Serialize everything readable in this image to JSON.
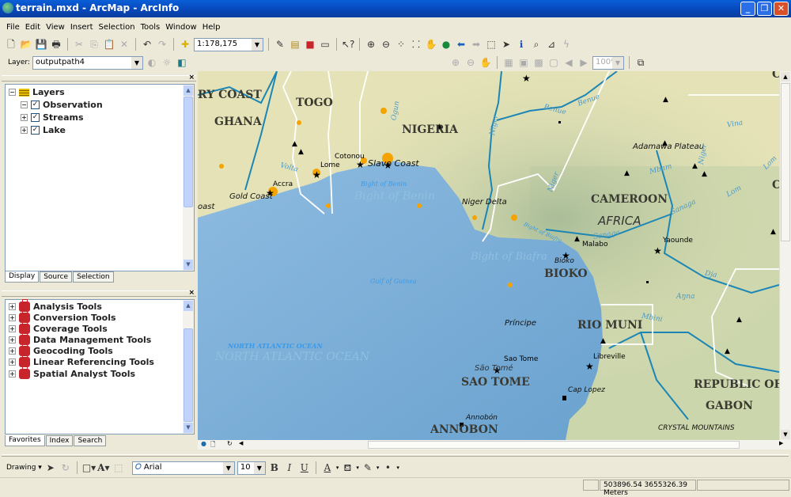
{
  "window": {
    "title": "terrain.mxd - ArcMap - ArcInfo",
    "controls": [
      "minimize",
      "maximize",
      "close"
    ]
  },
  "menu": [
    "File",
    "Edit",
    "View",
    "Insert",
    "Selection",
    "Tools",
    "Window",
    "Help"
  ],
  "standard_toolbar": {
    "scale": "1:178,175",
    "icons": [
      "new-icon",
      "open-icon",
      "save-icon",
      "print-icon",
      "cut-icon",
      "copy-icon",
      "paste-icon",
      "delete-icon",
      "undo-icon",
      "redo-icon",
      "add-data-icon",
      "editor-icon",
      "arccatalog-icon",
      "arctoolbox-icon",
      "command-line-icon",
      "whats-this-icon"
    ]
  },
  "tools_toolbar": {
    "icons": [
      "zoom-in-icon",
      "zoom-out-icon",
      "fixed-zoom-in-icon",
      "fixed-zoom-out-icon",
      "pan-icon",
      "full-extent-icon",
      "back-icon",
      "forward-icon",
      "select-features-icon",
      "select-elements-icon",
      "identify-icon",
      "find-icon",
      "measure-icon",
      "hyperlink-icon"
    ]
  },
  "effects_toolbar": {
    "layer_label": "Layer:",
    "layer_value": "outputpath4"
  },
  "layout_toolbar": {
    "zoom": "100%"
  },
  "toc": {
    "root": "Layers",
    "layers": [
      {
        "name": "Observation",
        "checked": true,
        "expanded": true
      },
      {
        "name": "Streams",
        "checked": true,
        "expanded": false
      },
      {
        "name": "Lake",
        "checked": true,
        "expanded": false
      }
    ],
    "tabs": [
      "Display",
      "Source",
      "Selection"
    ],
    "active_tab": "Display"
  },
  "toolbox": {
    "items": [
      "Analysis Tools",
      "Conversion Tools",
      "Coverage Tools",
      "Data Management Tools",
      "Geocoding Tools",
      "Linear Referencing Tools",
      "Spatial Analyst Tools"
    ],
    "tabs": [
      "Favorites",
      "Index",
      "Search"
    ],
    "active_tab": "Favorites"
  },
  "map": {
    "countries": [
      "RY COAST",
      "TOGO",
      "GHANA",
      "NIGERIA",
      "CAMEROON",
      "BIOKO",
      "RIO MUNI",
      "SAO TOME",
      "REPUBLIC OF",
      "GABON",
      "ANNOBON",
      "C",
      "C"
    ],
    "cities": [
      "Cotonou",
      "Lome",
      "Accra",
      "Malabo",
      "Yaounde",
      "Sao Tome",
      "Libreville"
    ],
    "places": [
      "Slave Coast",
      "Gold Coast",
      "oast",
      "Niger Delta",
      "Adamawa Plateau",
      "AFRICA",
      "Bioko",
      "Príncipe",
      "São Tomé",
      "Cap Lopez",
      "Annobón",
      "CRYSTAL MOUNTAINS"
    ],
    "water": [
      "Bight of Benin",
      "Bight of Benin",
      "Gulf of Guinea",
      "Bight of Biafra",
      "Bight of Biafra",
      "NORTH ATLANTIC OCEAN",
      "NORTH ATLANTIC OCEAN"
    ],
    "rivers": [
      "Volta",
      "Ogun",
      "Niger",
      "Niger",
      "Benue",
      "Benue",
      "Vina",
      "Mbam",
      "Lom",
      "Lom",
      "Sanaga",
      "Sanaga",
      "Dja",
      "Mbini",
      "Aŋna"
    ],
    "colors": {
      "sea": "#7fb0d8",
      "land": "#e4e2b6",
      "highland": "#b8c9a4",
      "river": "#1b86b5",
      "urban": "#f5a300",
      "border": "#ffffff"
    }
  },
  "drawing_toolbar": {
    "drawing_label": "Drawing",
    "font": "Arial",
    "font_size": "10",
    "bold": "B",
    "italic": "I",
    "underline": "U",
    "text_a": "A"
  },
  "status": {
    "coordinates": "503896.54  3655326.39 Meters"
  }
}
